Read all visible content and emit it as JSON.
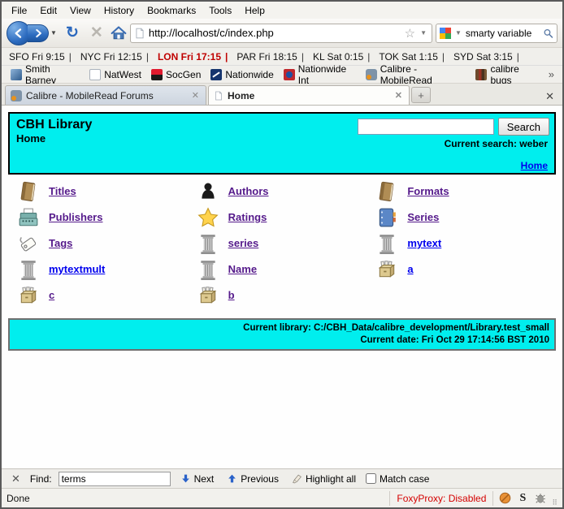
{
  "colors": {
    "page_accent_cyan": "#00eeee",
    "visited_link": "#551a8b",
    "unvisited_link": "#0000ee",
    "alert_red": "#c00000",
    "status_red": "#d40000"
  },
  "menu_bar": {
    "items": [
      "File",
      "Edit",
      "View",
      "History",
      "Bookmarks",
      "Tools",
      "Help"
    ]
  },
  "nav_bar": {
    "url": "http://localhost/c/index.php",
    "search_value": "smarty variable"
  },
  "clock_bar": {
    "zones": [
      {
        "label": "SFO Fri 9:15",
        "highlight": false
      },
      {
        "label": "NYC Fri 12:15",
        "highlight": false
      },
      {
        "label": "LON Fri 17:15",
        "highlight": true
      },
      {
        "label": "PAR Fri 18:15",
        "highlight": false
      },
      {
        "label": "KL Sat 0:15",
        "highlight": false
      },
      {
        "label": "TOK Sat 1:15",
        "highlight": false
      },
      {
        "label": "SYD Sat 3:15",
        "highlight": false
      }
    ]
  },
  "bookmarks_bar": {
    "items": [
      {
        "label": "Smith Barney"
      },
      {
        "label": "NatWest"
      },
      {
        "label": "SocGen"
      },
      {
        "label": "Nationwide"
      },
      {
        "label": "Nationwide Int"
      },
      {
        "label": "Calibre - MobileRead"
      },
      {
        "label": "calibre bugs"
      }
    ],
    "overflow": "»"
  },
  "tab_bar": {
    "tabs": [
      {
        "title": "Calibre - MobileRead Forums",
        "active": false
      },
      {
        "title": "Home",
        "active": true
      }
    ],
    "new_tab": "+",
    "close_all": "✕"
  },
  "page": {
    "header": {
      "title": "CBH Library",
      "subtitle": "Home",
      "search_button": "Search",
      "search_value": "",
      "current_search": "Current search: weber",
      "home_link": "Home"
    },
    "grid": {
      "items": [
        {
          "label": "Titles",
          "icon": "book",
          "visited": true
        },
        {
          "label": "Authors",
          "icon": "person",
          "visited": true
        },
        {
          "label": "Formats",
          "icon": "book",
          "visited": true
        },
        {
          "label": "Publishers",
          "icon": "typewriter",
          "visited": true
        },
        {
          "label": "Ratings",
          "icon": "star",
          "visited": true
        },
        {
          "label": "Series",
          "icon": "notebook",
          "visited": true
        },
        {
          "label": "Tags",
          "icon": "tag",
          "visited": true
        },
        {
          "label": "series",
          "icon": "column",
          "visited": true
        },
        {
          "label": "mytext",
          "icon": "column",
          "visited": false
        },
        {
          "label": "mytextmult",
          "icon": "column",
          "visited": false
        },
        {
          "label": "Name",
          "icon": "column",
          "visited": true
        },
        {
          "label": "a",
          "icon": "drawer",
          "visited": false
        },
        {
          "label": "c",
          "icon": "drawer",
          "visited": true
        },
        {
          "label": "b",
          "icon": "drawer",
          "visited": true
        }
      ]
    },
    "footer": {
      "line1": "Current library: C:/CBH_Data/calibre_development/Library.test_small",
      "line2": "Current date: Fri Oct 29 17:14:56 BST 2010"
    }
  },
  "find_bar": {
    "close": "✕",
    "label": "Find:",
    "value": "terms",
    "next": "Next",
    "previous": "Previous",
    "highlight_all": "Highlight all",
    "match_case": "Match case"
  },
  "status_bar": {
    "left": "Done",
    "foxyproxy": "FoxyProxy: Disabled"
  }
}
